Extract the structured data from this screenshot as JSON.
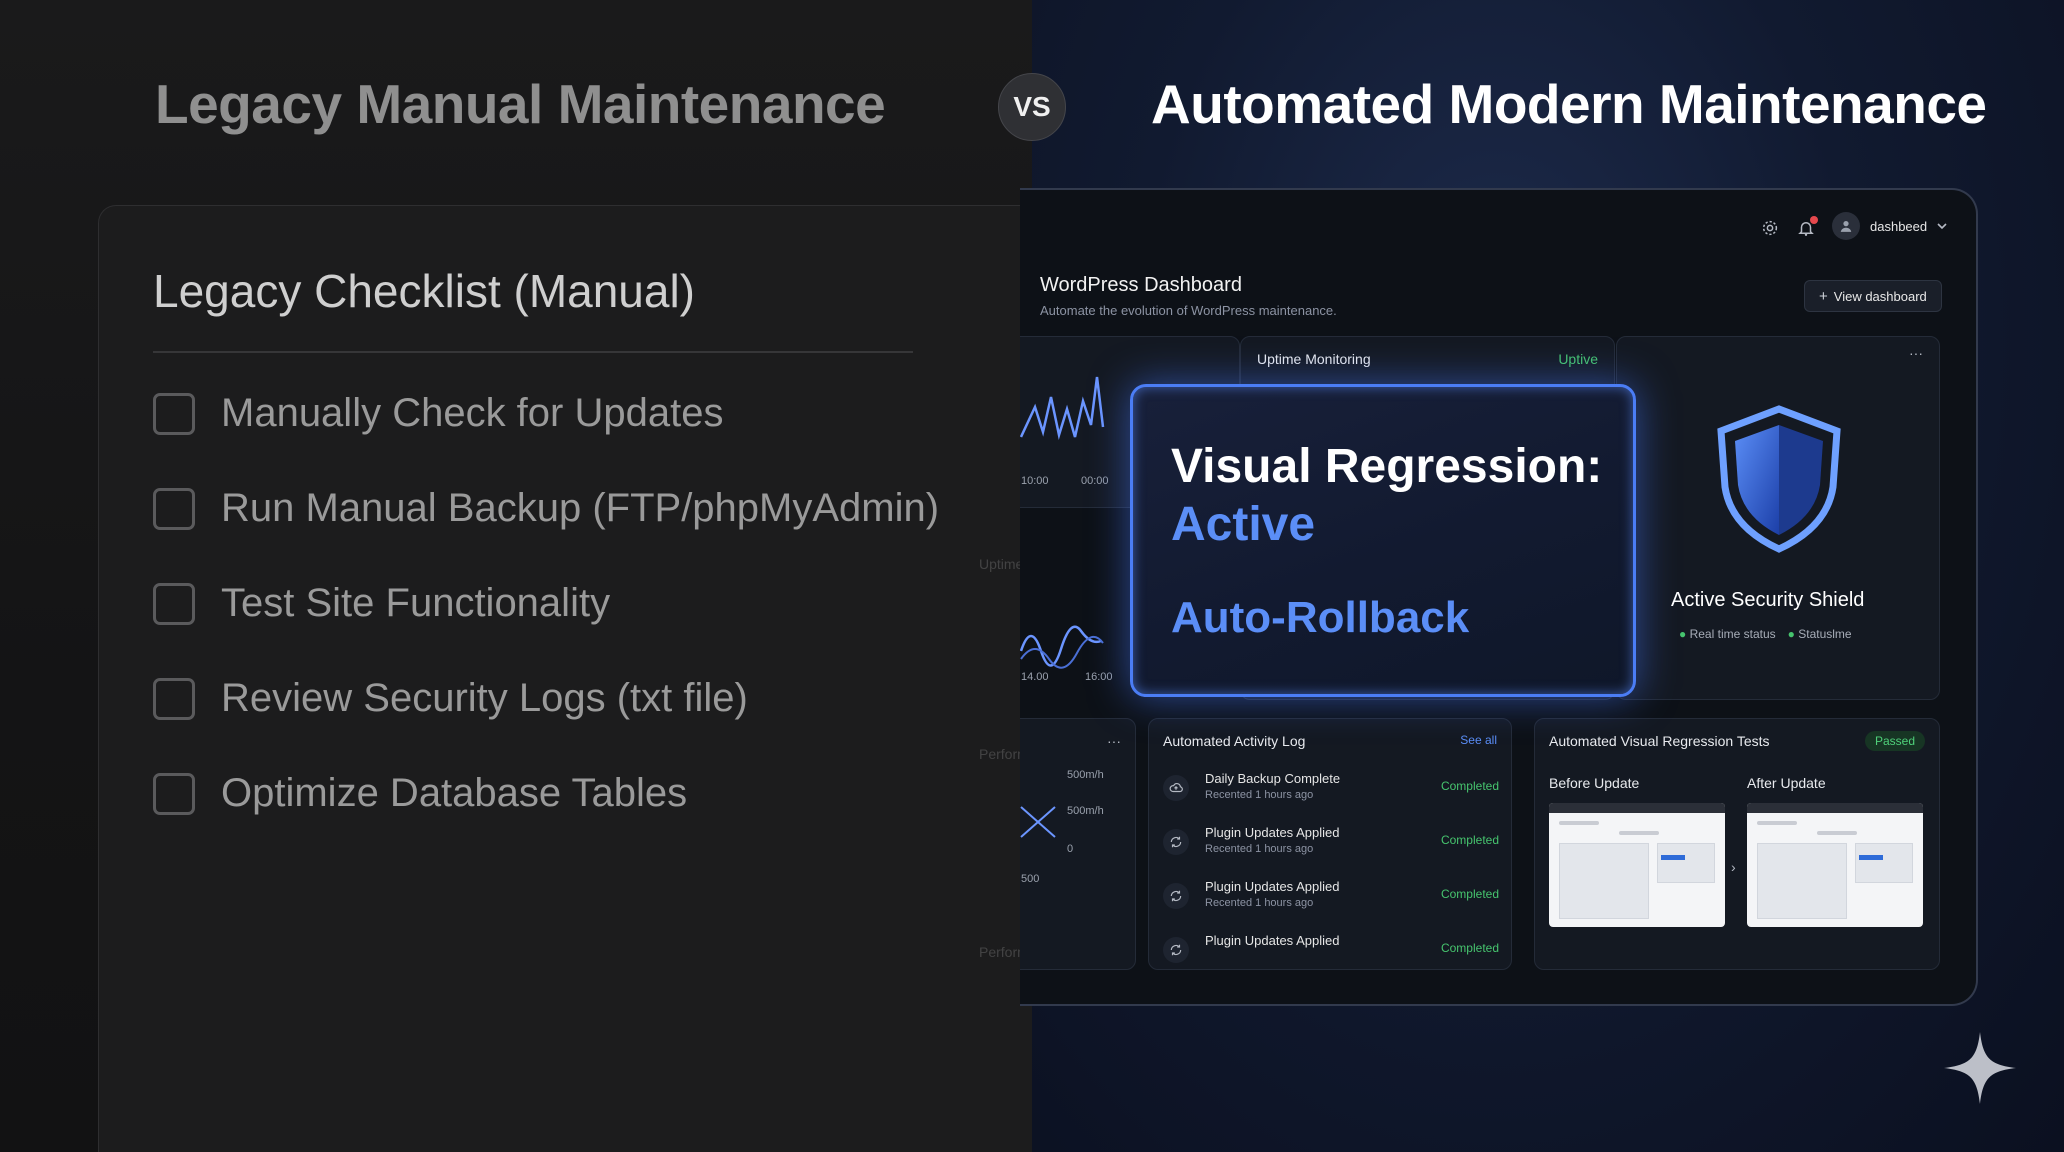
{
  "legacy": {
    "heading": "Legacy Manual Maintenance",
    "panel_title": "Legacy Checklist (Manual)",
    "items": [
      "Manually Check for Updates",
      "Run Manual Backup (FTP/phpMyAdmin)",
      "Test Site Functionality",
      "Review Security Logs (txt file)",
      "Optimize Database Tables"
    ],
    "ghost_labels": [
      "Uptime Monitoring",
      "Performance Metrics",
      "Performance Metrics"
    ]
  },
  "vs_label": "VS",
  "modern": {
    "heading": "Automated Modern Maintenance",
    "header": {
      "user_name": "dashbeed"
    },
    "dashboard_title": "WordPress Dashboard",
    "dashboard_subtitle": "Automate the evolution of WordPress maintenance.",
    "view_dashboard_label": "View dashboard",
    "left_chart_ticks_top": [
      "10:00",
      "00:00"
    ],
    "left_chart_ticks_mid": [
      "14.00",
      "16:00"
    ],
    "left_chart_ticks_bottom": [
      "500m/h",
      "500m/h",
      "0",
      "500"
    ],
    "uptime_card": {
      "title": "Uptime Monitoring",
      "status": "Uptive"
    },
    "security_card": {
      "title": "Active Security Shield",
      "legend": [
        "Real time status",
        "Statuslme"
      ]
    },
    "overlay_card": {
      "line1": "Visual Regression:",
      "line2": "Active",
      "line3": "Auto-Rollback"
    },
    "activity_log": {
      "title": "Automated Activity Log",
      "see_all": "See all",
      "rows": [
        {
          "title": "Daily Backup Complete",
          "subtitle": "Recented 1 hours ago",
          "status": "Completed",
          "icon": "cloud-upload-icon"
        },
        {
          "title": "Plugin Updates Applied",
          "subtitle": "Recented 1 hours ago",
          "status": "Completed",
          "icon": "refresh-icon"
        },
        {
          "title": "Plugin Updates Applied",
          "subtitle": "Recented 1 hours ago",
          "status": "Completed",
          "icon": "refresh-icon"
        },
        {
          "title": "Plugin Updates Applied",
          "subtitle": "",
          "status": "Completed",
          "icon": "refresh-icon"
        }
      ]
    },
    "regression_tests": {
      "title": "Automated Visual Regression Tests",
      "badge": "Passed",
      "before_label": "Before Update",
      "after_label": "After Update"
    }
  },
  "colors": {
    "accent": "#5b8ef7",
    "success": "#46c46e",
    "glow": "#4b7df5"
  }
}
